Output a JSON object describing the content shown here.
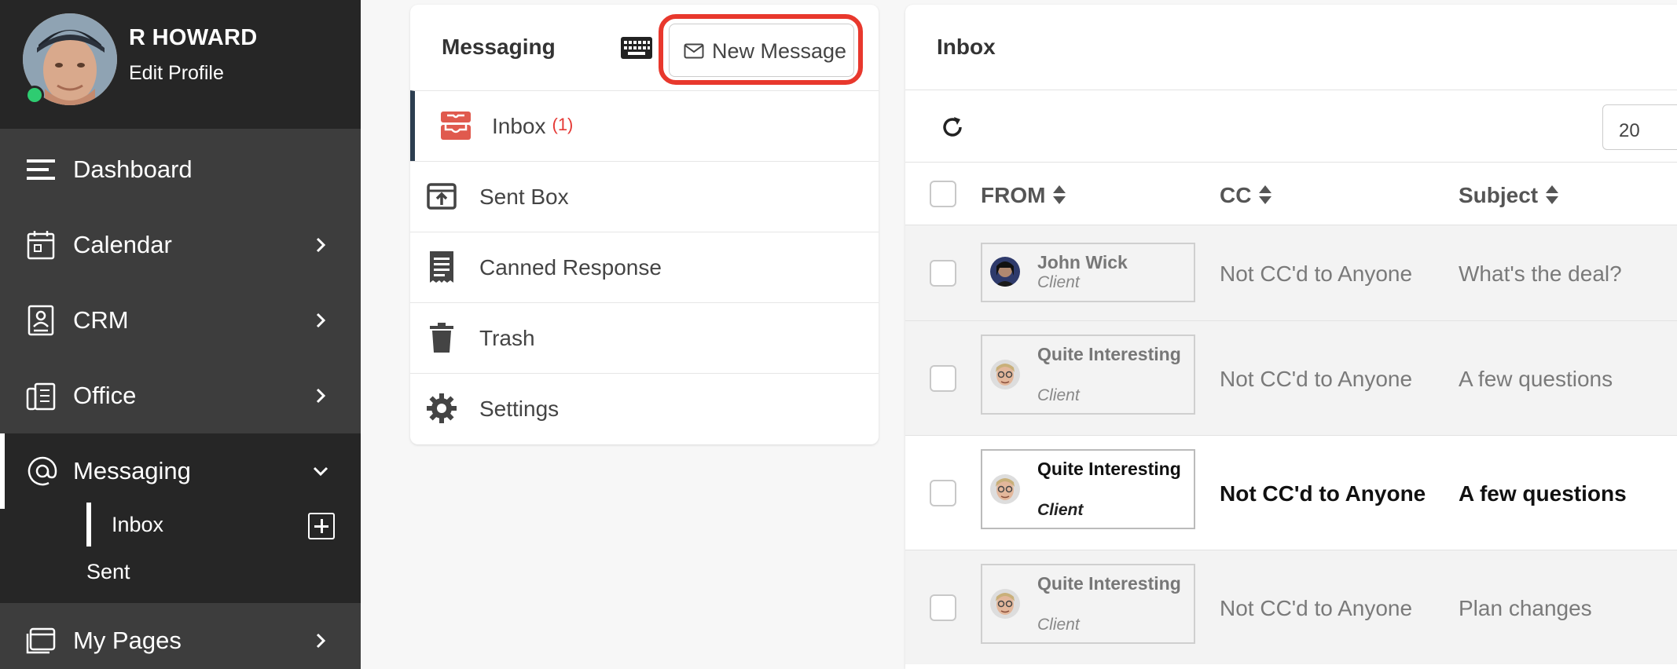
{
  "profile": {
    "name": "R HOWARD",
    "edit_label": "Edit Profile"
  },
  "nav": {
    "dashboard": "Dashboard",
    "calendar": "Calendar",
    "crm": "CRM",
    "office": "Office",
    "messaging": "Messaging",
    "messaging_sub": {
      "inbox": "Inbox",
      "sent": "Sent"
    },
    "my_pages": "My Pages"
  },
  "messaging_panel": {
    "title": "Messaging",
    "new_message": "New Message",
    "folders": {
      "inbox": "Inbox",
      "inbox_count": "(1)",
      "sent": "Sent Box",
      "canned": "Canned Response",
      "trash": "Trash",
      "settings": "Settings"
    }
  },
  "inbox": {
    "title": "Inbox",
    "page_size": "20",
    "columns": {
      "from": "FROM",
      "cc": "CC",
      "subject": "Subject"
    },
    "rows": [
      {
        "from_name": "John Wick",
        "from_role": "Client",
        "cc": "Not CC'd to Anyone",
        "subject": "What's the deal?",
        "read": true
      },
      {
        "from_name": "Quite Interesting",
        "from_role": "Client",
        "cc": "Not CC'd to Anyone",
        "subject": "A few questions",
        "read": true
      },
      {
        "from_name": "Quite Interesting",
        "from_role": "Client",
        "cc": "Not CC'd to Anyone",
        "subject": "A few questions",
        "read": false
      },
      {
        "from_name": "Quite Interesting",
        "from_role": "Client",
        "cc": "Not CC'd to Anyone",
        "subject": "Plan changes",
        "read": true
      }
    ]
  },
  "colors": {
    "accent_red": "#e8382d",
    "online": "#2ecc71",
    "sidebar": "#3d3d3d",
    "sidebar_dark": "#262626",
    "inbox_icon": "#e05a4e"
  }
}
